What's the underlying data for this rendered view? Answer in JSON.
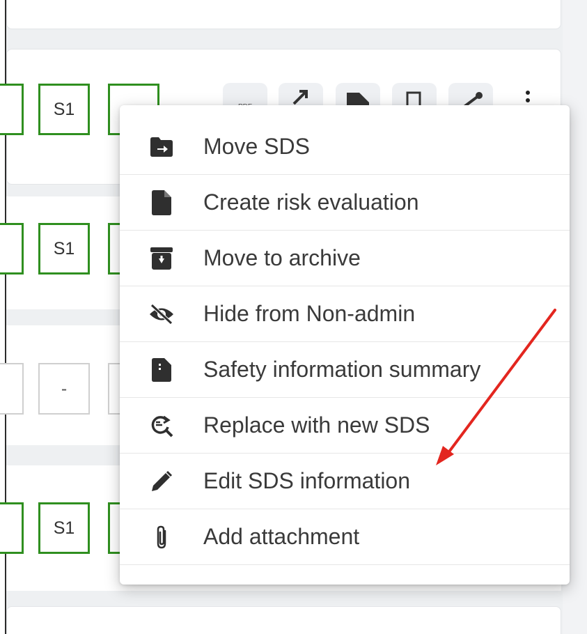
{
  "rows": [
    {
      "badges": [
        "S1"
      ]
    },
    {
      "badges": [
        "S1"
      ]
    },
    {
      "badges": [
        "-"
      ]
    },
    {
      "badges": [
        "S1"
      ]
    }
  ],
  "toolbar": {
    "pdf_label": "PDF"
  },
  "menu": {
    "items": [
      {
        "label": "Move SDS",
        "icon": "folder-move-icon"
      },
      {
        "label": "Create risk evaluation",
        "icon": "document-icon"
      },
      {
        "label": "Move to archive",
        "icon": "archive-icon"
      },
      {
        "label": "Hide from Non-admin",
        "icon": "eye-slash-icon"
      },
      {
        "label": "Safety information summary",
        "icon": "file-summary-icon"
      },
      {
        "label": "Replace with new SDS",
        "icon": "replace-search-icon"
      },
      {
        "label": "Edit SDS information",
        "icon": "pencil-icon"
      },
      {
        "label": "Add attachment",
        "icon": "paperclip-icon"
      }
    ]
  },
  "annotation": {
    "arrow_color": "#e3261f"
  },
  "colors": {
    "badge_border": "#2f8f1f",
    "menu_text": "#3a3a3a"
  }
}
